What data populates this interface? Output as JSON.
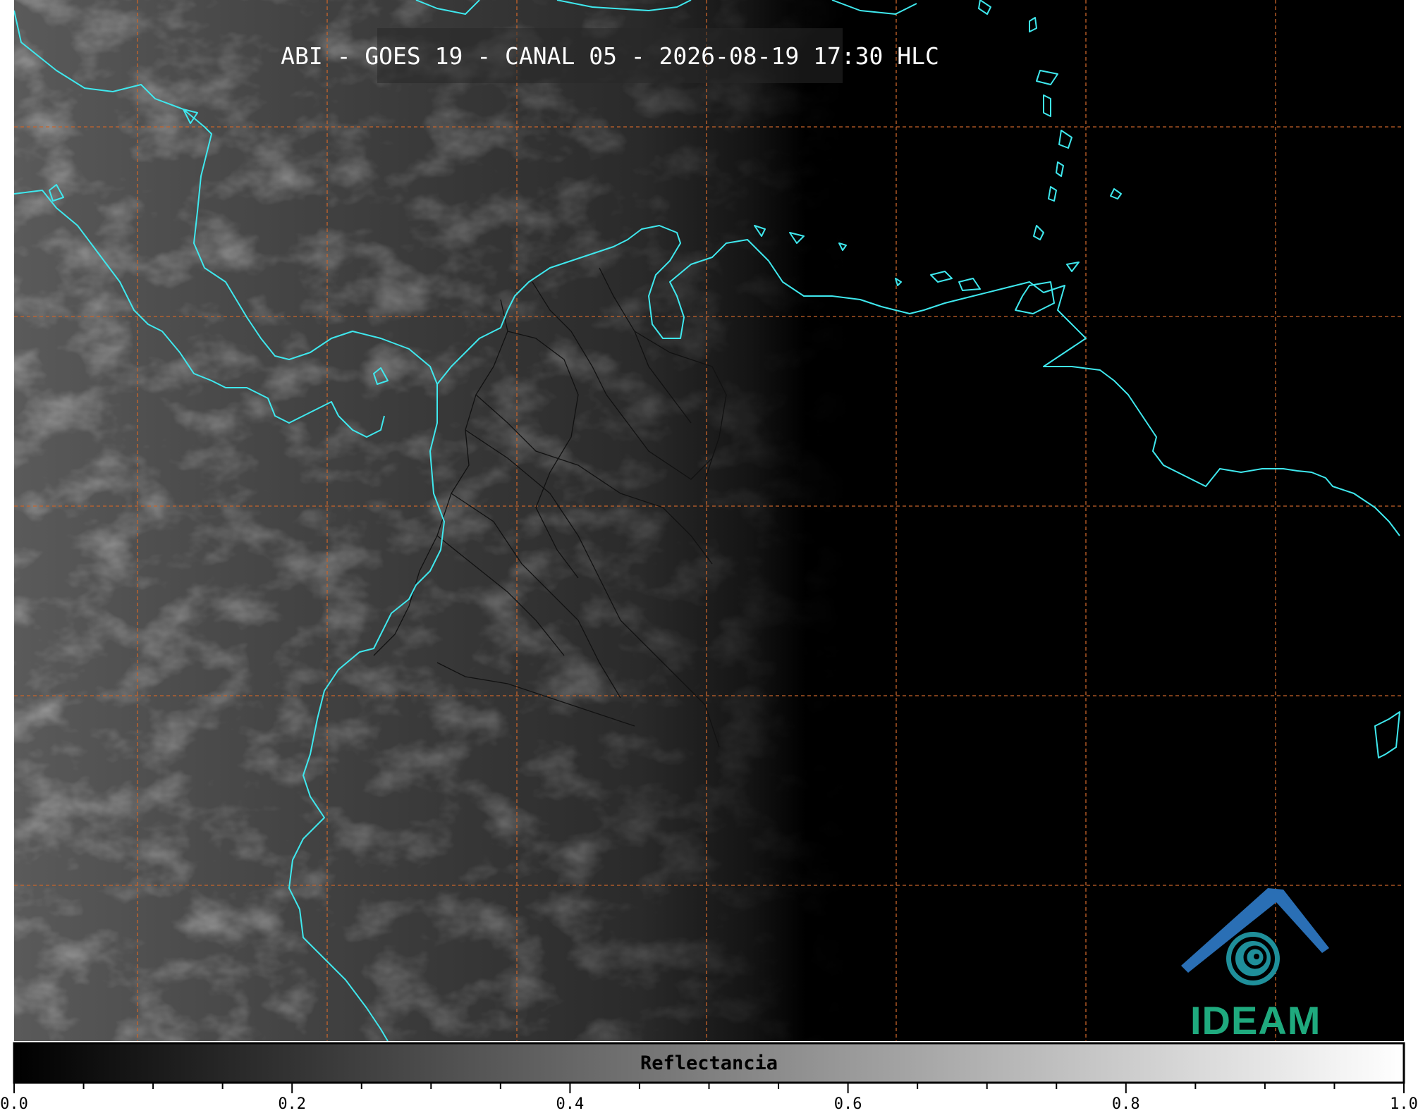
{
  "title": "ABI - GOES 19 - CANAL 05 - 2026-08-19 17:30 HLC",
  "colorbar": {
    "label": "Reflectancia",
    "range": [
      0.0,
      1.0
    ],
    "tick_labels": [
      "0.0",
      "0.2",
      "0.4",
      "0.6",
      "0.8",
      "1.0"
    ]
  },
  "logo": {
    "text": "IDEAM"
  },
  "colors": {
    "coastline": "#3fe8ee",
    "gridline": "#c8642a",
    "borders": "#111111",
    "logo_blue": "#2a6fb5",
    "logo_green": "#1faa7e"
  },
  "map_features": {
    "graticule": "dashed",
    "coastlines": true,
    "political_borders": true,
    "imagery": "visible reflectance, grayscale"
  }
}
